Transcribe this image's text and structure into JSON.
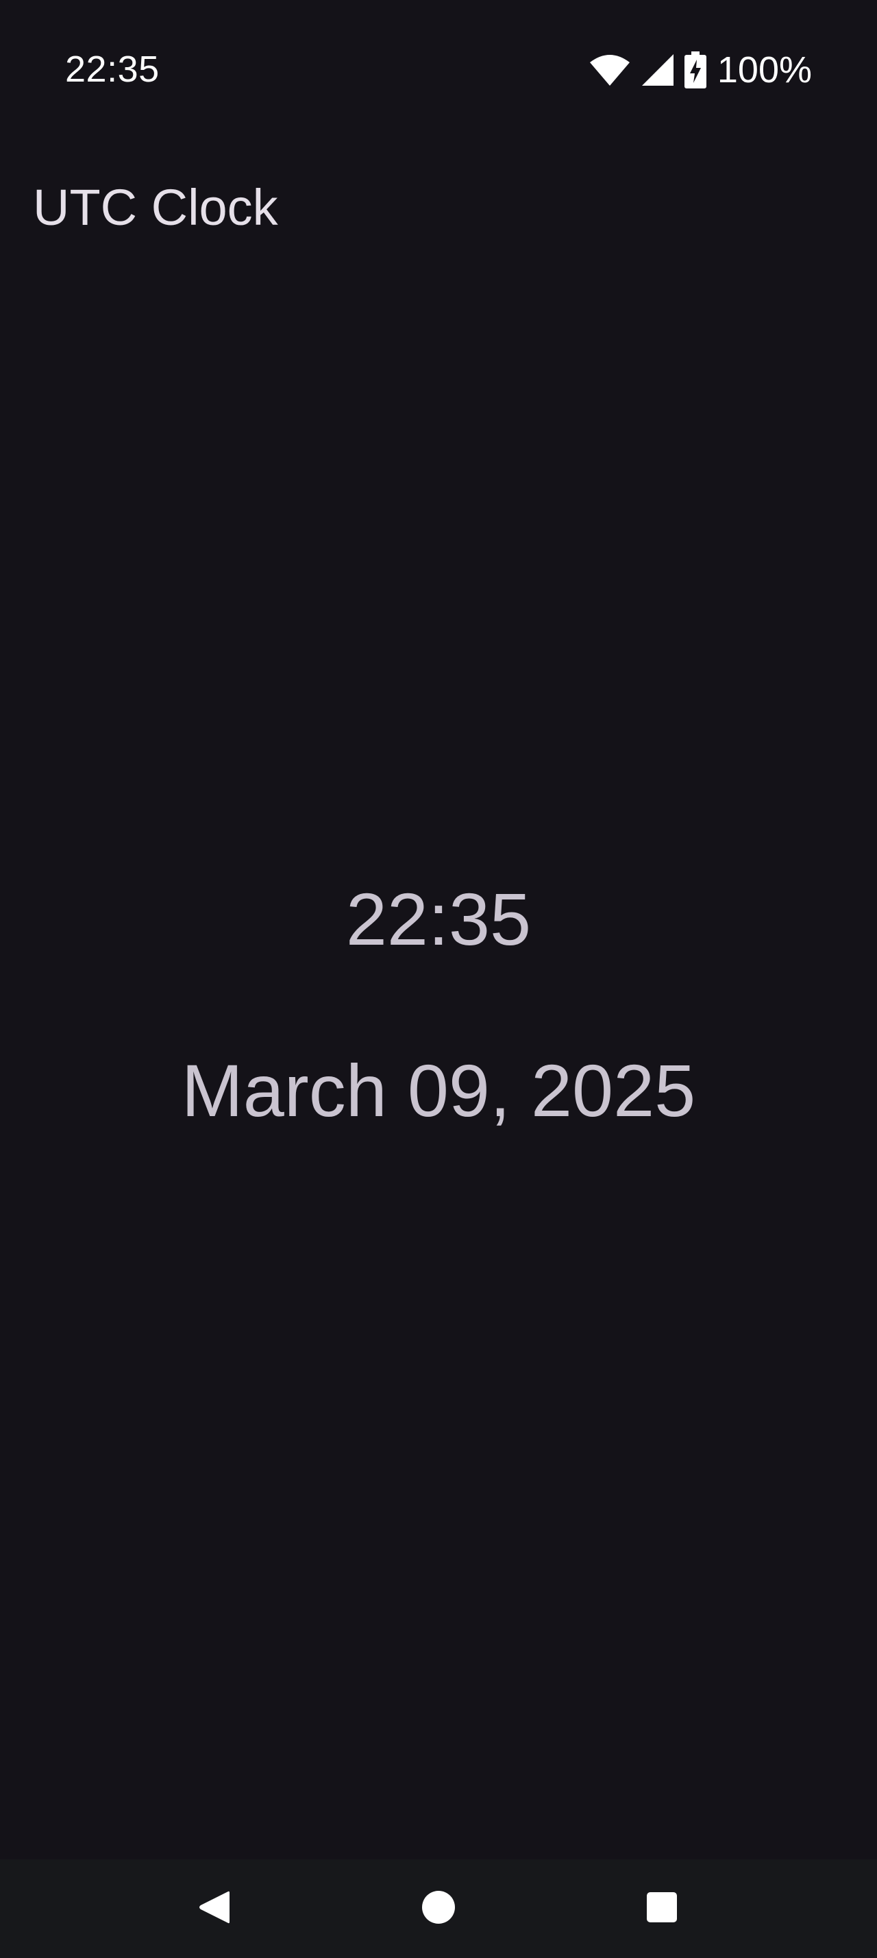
{
  "status_bar": {
    "time": "22:35",
    "battery_percent": "100%",
    "icons": [
      "wifi-icon",
      "cellular-signal-icon",
      "battery-charging-icon"
    ]
  },
  "app_bar": {
    "title": "UTC Clock"
  },
  "clock": {
    "time": "22:35",
    "date": "March 09, 2025"
  },
  "nav_bar": {
    "buttons": [
      "back-icon",
      "home-icon",
      "recents-icon"
    ]
  },
  "colors": {
    "background": "#141218",
    "title_text": "#e6e0e9",
    "clock_text": "#cac4d0",
    "nav_bar_background": "#17181b",
    "status_text": "#ffffff"
  }
}
